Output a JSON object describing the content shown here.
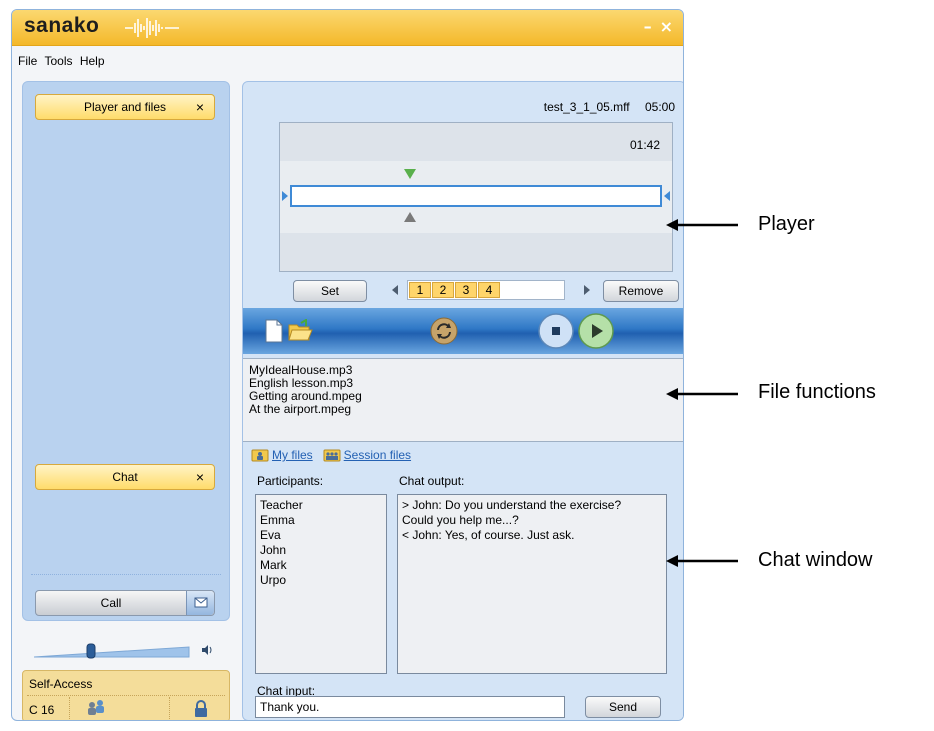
{
  "app": {
    "logo": "sanako"
  },
  "menu": [
    "File",
    "Tools",
    "Help"
  ],
  "left_panel": {
    "player_tab": "Player and files",
    "chat_tab": "Chat",
    "close_glyph": "×",
    "call_label": "Call",
    "volume_level": 0.38
  },
  "self_access": {
    "title": "Self-Access",
    "seat": "C 16"
  },
  "player": {
    "file_name": "test_3_1_05.mff",
    "duration": "05:00",
    "position": "01:42",
    "set_label": "Set",
    "remove_label": "Remove",
    "markers": [
      "1",
      "2",
      "3",
      "4"
    ]
  },
  "files": {
    "list": [
      "MyIdealHouse.mp3",
      "English lesson.mp3",
      "Getting around.mpeg",
      "At the airport.mpeg"
    ],
    "tab_my": "My files",
    "tab_session": "Session files"
  },
  "chat": {
    "participants_label": "Participants:",
    "participants": [
      "Teacher",
      "Emma",
      "Eva",
      "John",
      "Mark",
      "Urpo"
    ],
    "output_label": "Chat output:",
    "output": [
      "> John: Do you understand the exercise?",
      "Could you help me...?",
      "< John: Yes, of course. Just ask."
    ],
    "input_label": "Chat input:",
    "input_value": "Thank you.",
    "send_label": "Send"
  },
  "annotations": {
    "player": "Player",
    "file_functions": "File functions",
    "chat_window": "Chat window"
  },
  "colors": {
    "title_bar": "#f4b82a",
    "panel_blue": "#b9d2ef",
    "accent_blue": "#2f78c6",
    "marker_yellow": "#ffd56a"
  }
}
